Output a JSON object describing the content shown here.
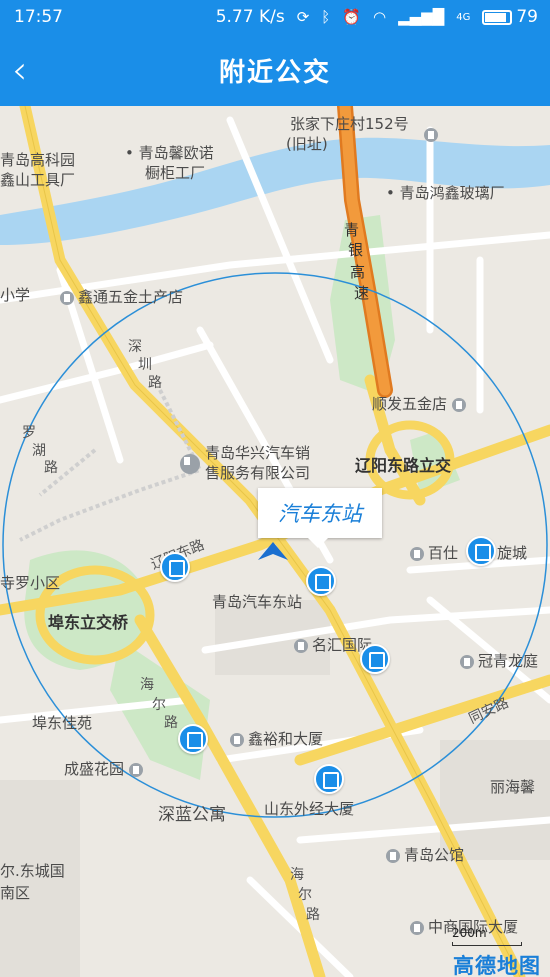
{
  "status_bar": {
    "time": "17:57",
    "speed": "5.77",
    "speed_unit": "K/s",
    "network": "4G",
    "battery": "79"
  },
  "app_bar": {
    "title": "附近公交",
    "back_icon": "chevron-left-icon"
  },
  "map": {
    "callout": "汽车东站",
    "labels": {
      "zhangjia": "张家下庄村152号",
      "zhangjia2": "(旧址)",
      "gaokeyuan": "青岛高科园",
      "xinshan": "鑫山工具厂",
      "xinou": "青岛馨欧诺",
      "chugui": "橱柜工厂",
      "hongxin": "青岛鸿鑫玻璃厂",
      "qingyin": "青",
      "qingyin2": "银",
      "qingyin3": "高",
      "qingyin4": "速",
      "xiaoxue": "小学",
      "xintong": "鑫通五金土产店",
      "shenzhen": "深",
      "shenzhen2": "圳",
      "shenzhen3": "路",
      "shunfa": "顺发五金店",
      "luohu": "罗",
      "luohu2": "湖",
      "luohu3": "路",
      "huaxing": "青岛华兴汽车销",
      "huaxing2": "售服务有限公司",
      "liaoyang_overpass": "辽阳东路立交",
      "baishi": "百仕",
      "xuancheng": "旋城",
      "liaoyang_road": "辽阳东路",
      "luoxiaoqu": "寺罗小区",
      "qingdao_bus": "青岛汽车东站",
      "budong_overpass": "埠东立交桥",
      "minghui": "名汇国际",
      "guanqing": "冠青龙庭",
      "haier": "海",
      "haier2": "尔",
      "haier3": "路",
      "budong_jiayuan": "埠东佳苑",
      "xinyu": "鑫裕和大厦",
      "tongan": "同安路",
      "chengsheng": "成盛花园",
      "lihai": "丽海馨",
      "shenlan": "深蓝公寓",
      "shandong": "山东外经大厦",
      "dongcheng": "尔.东城国",
      "nanqu": "南区",
      "gongguan": "青岛公馆",
      "haier_s": "海",
      "haier_s2": "尔",
      "haier_s3": "路",
      "zhongshang": "中商国际大厦"
    },
    "scale": "200m",
    "logo": "高德地图"
  }
}
